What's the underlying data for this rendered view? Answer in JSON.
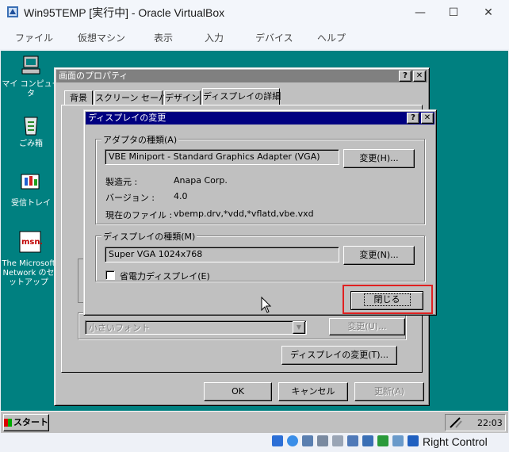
{
  "host": {
    "title": "Win95TEMP [実行中] - Oracle VirtualBox",
    "controls": {
      "minimize": "—",
      "maximize": "☐",
      "close": "✕"
    },
    "menu": [
      "ファイル",
      "仮想マシン",
      "表示",
      "入力",
      "デバイス",
      "ヘルプ"
    ],
    "status_right": "Right Control"
  },
  "desktop": {
    "icons": [
      {
        "label": "マイ コンピュータ",
        "icon": "my-computer-icon"
      },
      {
        "label": "ごみ箱",
        "icon": "recycle-bin-icon"
      },
      {
        "label": "受信トレイ",
        "icon": "inbox-icon"
      },
      {
        "label": "The Microsoft Network のセットアップ",
        "icon": "msn-icon"
      }
    ]
  },
  "props_window": {
    "title": "画面のプロパティ",
    "tabs": [
      "背景",
      "スクリーン セーバー",
      "デザイン",
      "ディスプレイの詳細"
    ],
    "font_select": "小さいフォント",
    "change_font_button": "変更(U)...",
    "change_display_button": "ディスプレイの変更(T)...",
    "ok": "OK",
    "cancel": "キャンセル",
    "apply": "更新(A)"
  },
  "change_dialog": {
    "title": "ディスプレイの変更",
    "adapter_group": "アダプタの種類(A)",
    "adapter_name": "VBE Miniport - Standard Graphics Adapter (VGA)",
    "adapter_change_button": "変更(H)...",
    "manufacturer_label": "製造元 :",
    "manufacturer_value": "Anapa Corp.",
    "version_label": "バージョン :",
    "version_value": "4.0",
    "files_label": "現在のファイル :",
    "files_value": "vbemp.drv,*vdd,*vflatd,vbe.vxd",
    "monitor_group": "ディスプレイの種類(M)",
    "monitor_name": "Super VGA 1024x768",
    "monitor_change_button": "変更(N)...",
    "power_saving_label": "省電力ディスプレイ(E)",
    "power_saving_checked": false,
    "close_button": "閉じる",
    "help_button": "?",
    "close_x": "✕"
  },
  "taskbar": {
    "start": "スタート",
    "clock": "22:03"
  },
  "colors": {
    "desktop": "#008080",
    "active_title": "#000080",
    "inactive_title": "#808080",
    "highlight": "#e02020"
  }
}
